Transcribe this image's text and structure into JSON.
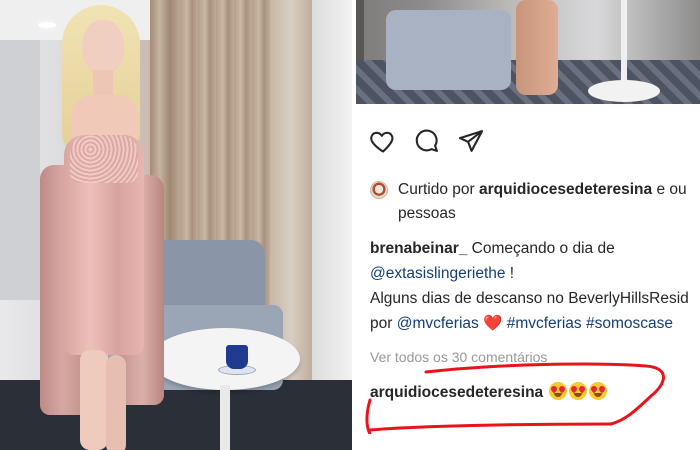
{
  "left_photo": {
    "description": ""
  },
  "post": {
    "actions": {
      "like_icon": "heart-outline-icon",
      "comment_icon": "speech-bubble-icon",
      "share_icon": "paper-plane-icon"
    },
    "liked_by": {
      "prefix": "Curtido por ",
      "user": "arquidiocesedeteresina",
      "suffix": " e ou",
      "line2": "pessoas"
    },
    "caption": {
      "username": "brenabeinar_",
      "line1_text": " Começando o dia de",
      "mention1": "@extasislingeriethe",
      "mention1_suffix": " !",
      "line3": "Alguns dias de descanso no BeverlyHillsResid",
      "line4_prefix": "por ",
      "mention2": "@mvcferias",
      "heart": "❤️",
      "hashtag1": "#mvcferias",
      "hashtag2": "#somoscase"
    },
    "view_comments": "Ver todos os 30 comentários",
    "comment": {
      "username": "arquidiocesedeteresina",
      "emoji_name": "heart-eyes-emoji",
      "emoji_count": 3
    },
    "annotation_color": "#e8141c"
  }
}
